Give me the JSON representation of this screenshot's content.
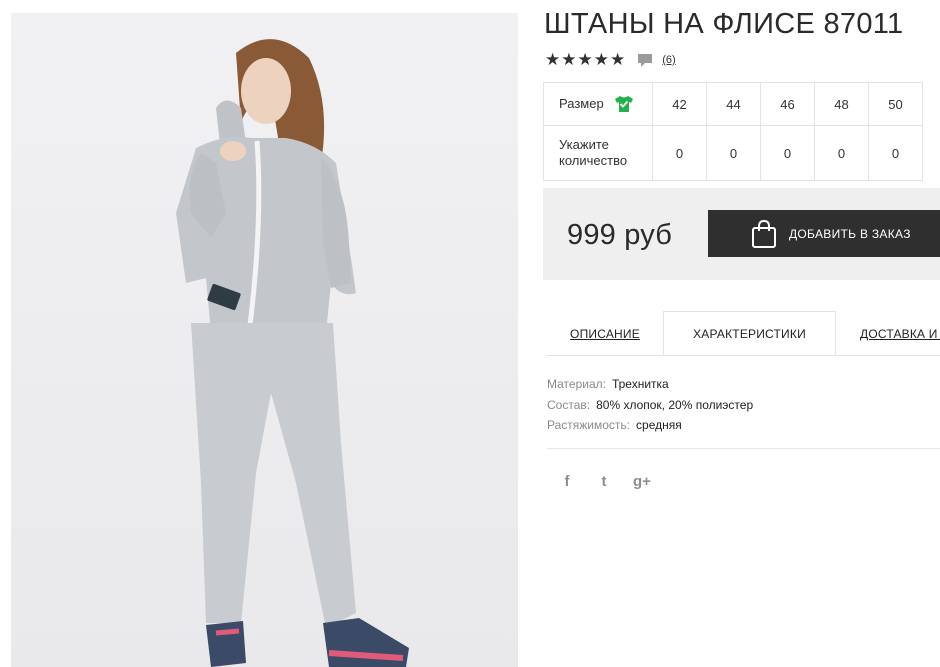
{
  "product": {
    "title": "ШТАНЫ НА ФЛИСЕ 87011",
    "rating": 5,
    "rating_max": 5,
    "review_count": "(6)",
    "price": "999 руб",
    "add_to_order_label": "ДОБАВИТЬ В ЗАКАЗ"
  },
  "size_table": {
    "size_label": "Размер",
    "quantity_label": "Укажите количество",
    "sizes": [
      "42",
      "44",
      "46",
      "48",
      "50"
    ],
    "quantities": [
      "0",
      "0",
      "0",
      "0",
      "0"
    ]
  },
  "tabs": [
    {
      "label": "ОПИСАНИЕ",
      "active": false
    },
    {
      "label": "ХАРАКТЕРИСТИКИ",
      "active": true
    },
    {
      "label": "ДОСТАВКА И ОПЛАТА",
      "active": false
    }
  ],
  "specs": [
    {
      "key": "Материал:",
      "value": "Трехнитка"
    },
    {
      "key": "Состав:",
      "value": "80% хлопок, 20% полиэстер"
    },
    {
      "key": "Растяжимость:",
      "value": "средняя"
    }
  ],
  "social": {
    "icons": [
      "facebook-icon",
      "twitter-icon",
      "google-plus-icon"
    ],
    "facebook_glyph": "f",
    "twitter_glyph": "t",
    "gplus_glyph": "g+"
  },
  "colors": {
    "button_bg": "#2f2f2f",
    "price_box_bg": "#efefef",
    "tshirt_icon_green": "#22b14c",
    "fabric_grey": "#c3c6cb"
  }
}
